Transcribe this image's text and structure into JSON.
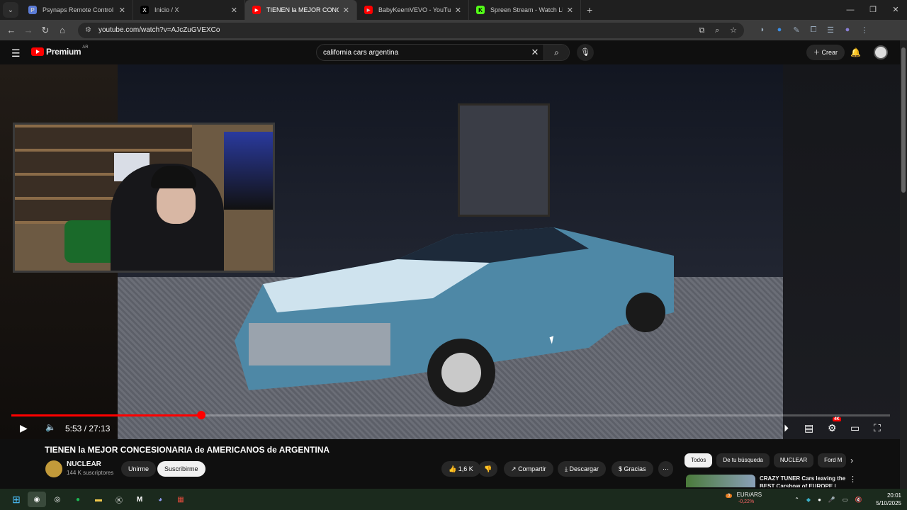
{
  "browser": {
    "tabs": [
      {
        "title": "Psynaps Remote Control",
        "fav_color": "#5b7bd5",
        "fav_glyph": "P"
      },
      {
        "title": "Inicio / X",
        "fav_color": "#000000",
        "fav_glyph": "X"
      },
      {
        "title": "TIENEN la MEJOR CONCESIONA",
        "fav_color": "#ff0000",
        "fav_glyph": "▶"
      },
      {
        "title": "BabyKeemVEVO - YouTube",
        "fav_color": "#ff0000",
        "fav_glyph": "▶"
      },
      {
        "title": "Spreen Stream - Watch Live on",
        "fav_color": "#53fc18",
        "fav_glyph": "K"
      }
    ],
    "active_tab": 2,
    "url": "youtube.com/watch?v=AJcZuGVEXCo"
  },
  "youtube": {
    "logo_text": "Premium",
    "region": "AR",
    "search_value": "california cars argentina",
    "create_label": "Crear"
  },
  "player": {
    "current_time": "5:53",
    "duration": "27:13",
    "time_display": "5:53 / 27:13",
    "progress_fraction": 0.2162,
    "quality_badge": "4K"
  },
  "video": {
    "title": "TIENEN la MEJOR CONCESIONARIA de AMERICANOS de ARGENTINA",
    "channel_name": "NUCLEAR",
    "subscribers": "144 K suscriptores",
    "join_label": "Unirme",
    "subscribe_label": "Suscribirme",
    "likes": "1,6 K",
    "share_label": "Compartir",
    "download_label": "Descargar",
    "thanks_label": "Gracias"
  },
  "related": {
    "chips": [
      "Todos",
      "De tu búsqueda",
      "NUCLEAR",
      "Ford M"
    ],
    "first_title": "CRAZY TUNER Cars leaving the BEST Carshow of EUROPE |"
  },
  "taskbar": {
    "fx_pair": "EUR/ARS",
    "fx_change": "-0,22%",
    "fx_badge": "3",
    "time": "20:01",
    "date": "5/10/2025"
  }
}
